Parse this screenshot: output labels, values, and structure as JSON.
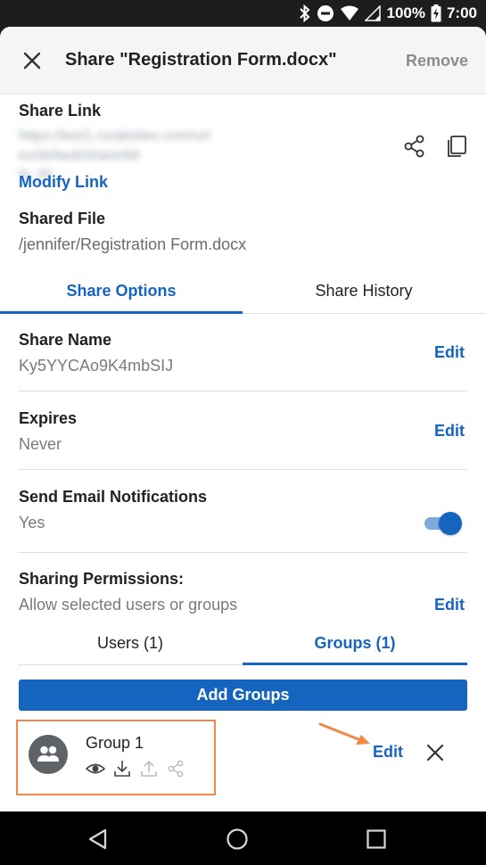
{
  "status_bar": {
    "battery": "100%",
    "time": "7:00"
  },
  "header": {
    "title": "Share \"Registration Form.docx\"",
    "remove_label": "Remove"
  },
  "share_link": {
    "label": "Share Link",
    "url_line1": "https://test1.rurabsites.com/url",
    "url_line2": "ex/default/share/k8",
    "url_line3": "fn_fS",
    "modify_label": "Modify Link"
  },
  "shared_file": {
    "label": "Shared File",
    "path": "/jennifer/Registration Form.docx"
  },
  "tabs": [
    {
      "label": "Share Options",
      "active": true
    },
    {
      "label": "Share History",
      "active": false
    }
  ],
  "options": {
    "share_name": {
      "label": "Share Name",
      "value": "Ky5YYCAo9K4mbSIJ",
      "edit": "Edit"
    },
    "expires": {
      "label": "Expires",
      "value": "Never",
      "edit": "Edit"
    },
    "email": {
      "label": "Send Email Notifications",
      "value": "Yes",
      "enabled": true
    },
    "permissions": {
      "label": "Sharing Permissions:",
      "value": "Allow selected users or groups",
      "edit": "Edit"
    }
  },
  "subtabs": [
    {
      "label": "Users (1)",
      "active": false
    },
    {
      "label": "Groups (1)",
      "active": true
    }
  ],
  "add_groups_label": "Add Groups",
  "group": {
    "name": "Group 1",
    "edit_label": "Edit",
    "permission_icons": [
      "view-icon",
      "download-icon",
      "upload-icon",
      "share-icon"
    ]
  },
  "colors": {
    "accent": "#1565c0",
    "highlight": "#f2894a",
    "muted": "#7a7a7a"
  }
}
